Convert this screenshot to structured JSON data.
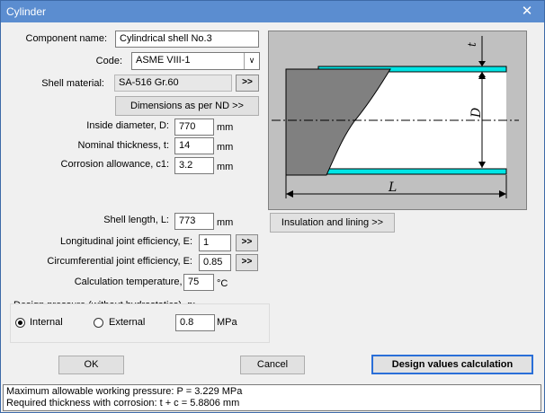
{
  "window": {
    "title": "Cylinder",
    "close_glyph": "✕"
  },
  "form": {
    "component_name": {
      "label": "Component name:",
      "value": "Cylindrical shell No.3"
    },
    "code": {
      "label": "Code:",
      "value": "ASME VIII-1",
      "arrow": "∨"
    },
    "shell_material": {
      "label": "Shell material:",
      "value": "SA-516 Gr.60",
      "button": ">>"
    },
    "dimensions_button": "Dimensions as per ND >>",
    "inside_diameter": {
      "label": "Inside diameter, D:",
      "value": "770",
      "unit": "mm"
    },
    "nominal_thickness": {
      "label": "Nominal thickness, t:",
      "value": "14",
      "unit": "mm"
    },
    "corrosion_allowance": {
      "label": "Corrosion allowance, c1:",
      "value": "3.2",
      "unit": "mm"
    },
    "shell_length": {
      "label": "Shell length, L:",
      "value": "773",
      "unit": "mm"
    },
    "longitudinal_joint": {
      "label": "Longitudinal joint efficiency, E:",
      "value": "1",
      "button": ">>"
    },
    "circumferential_joint": {
      "label": "Circumferential joint efficiency, E:",
      "value": "0.85",
      "button": ">>"
    },
    "calc_temperature": {
      "label": "Calculation temperature, T:",
      "value": "75",
      "unit": "°C"
    },
    "design_pressure": {
      "label": "Design pressure (without hydrostatics), p:",
      "internal": "Internal",
      "external": "External",
      "selected": "Internal",
      "value": "0.8",
      "unit": "MPa"
    }
  },
  "sketch": {
    "label_t": "t",
    "label_D": "D",
    "label_L": "L"
  },
  "insulation_button": "Insulation and lining >>",
  "buttons": {
    "ok": "OK",
    "cancel": "Cancel",
    "design": "Design values calculation"
  },
  "status": {
    "line1": "Maximum allowable working pressure: P = 3.229 MPa",
    "line2": "Required thickness with corrosion: t + c = 5.8806 mm"
  }
}
